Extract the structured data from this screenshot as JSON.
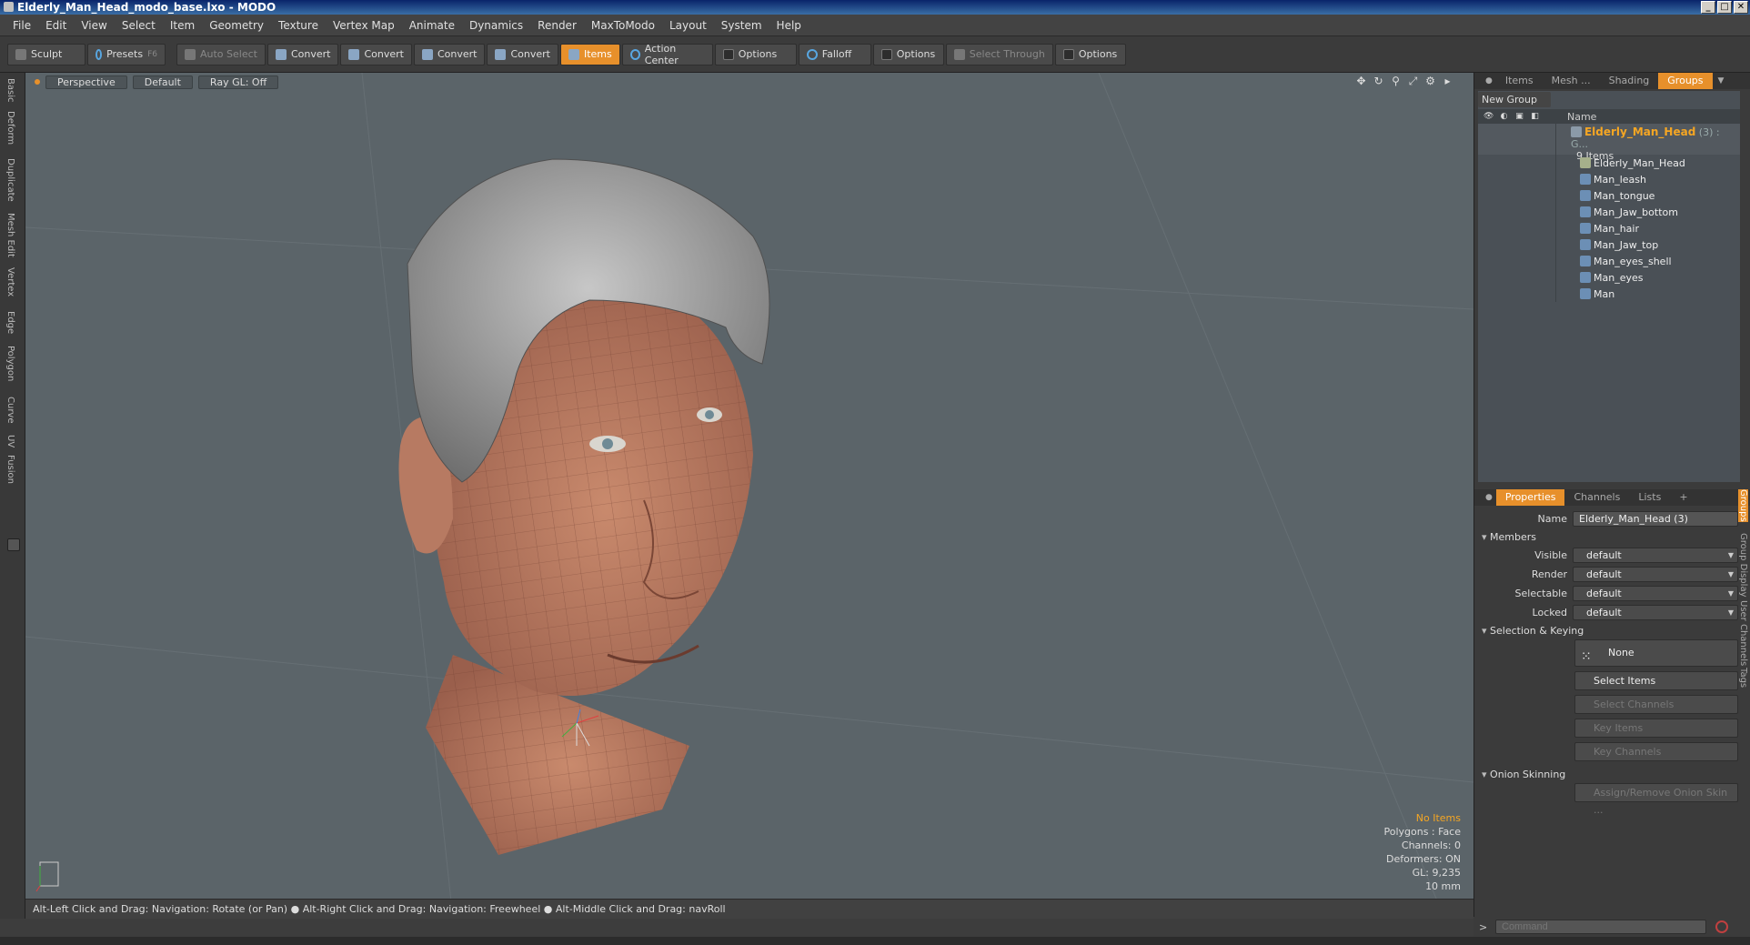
{
  "window": {
    "title": "Elderly_Man_Head_modo_base.lxo - MODO",
    "min": "_",
    "max": "□",
    "close": "✕"
  },
  "menu": [
    "File",
    "Edit",
    "View",
    "Select",
    "Item",
    "Geometry",
    "Texture",
    "Vertex Map",
    "Animate",
    "Dynamics",
    "Render",
    "MaxToModo",
    "Layout",
    "System",
    "Help"
  ],
  "toolbar": {
    "sculpt": "Sculpt",
    "presets": "Presets",
    "presets_key": "F6",
    "auto_select": "Auto Select",
    "convert1": "Convert",
    "convert2": "Convert",
    "convert3": "Convert",
    "convert4": "Convert",
    "items": "Items",
    "action_center": "Action Center",
    "options1": "Options",
    "falloff": "Falloff",
    "options2": "Options",
    "select_through": "Select Through",
    "options3": "Options"
  },
  "lefttabs": [
    "Basic",
    "Deform",
    "Duplicate",
    "Mesh Edit",
    "Vertex",
    "Edge",
    "Polygon",
    "Curve",
    "UV",
    "Fusion"
  ],
  "viewport": {
    "view": "Perspective",
    "shading": "Default",
    "raygl": "Ray GL: Off",
    "stats": {
      "items": "No Items",
      "polygons": "Polygons : Face",
      "channels": "Channels: 0",
      "deformers": "Deformers: ON",
      "gl": "GL: 9,235",
      "scale": "10 mm"
    },
    "hint": "Alt-Left Click and Drag: Navigation: Rotate (or Pan) ● Alt-Right Click and Drag: Navigation: Freewheel ● Alt-Middle Click and Drag: navRoll"
  },
  "rightpanel": {
    "tabs": [
      "Items",
      "Mesh ...",
      "Shading",
      "Groups"
    ],
    "new_group": "New Group",
    "tree_header": "Name",
    "group": {
      "name": "Elderly_Man_Head",
      "suffix": "(3) : G...",
      "count": "9 Items"
    },
    "members": [
      "Elderly_Man_Head",
      "Man_leash",
      "Man_tongue",
      "Man_Jaw_bottom",
      "Man_hair",
      "Man_Jaw_top",
      "Man_eyes_shell",
      "Man_eyes",
      "Man"
    ],
    "prop_tabs": [
      "Properties",
      "Channels",
      "Lists",
      "+"
    ],
    "props": {
      "name_label": "Name",
      "name_value": "Elderly_Man_Head (3)",
      "members_section": "Members",
      "visible_label": "Visible",
      "visible": "default",
      "render_label": "Render",
      "render": "default",
      "selectable_label": "Selectable",
      "selectable": "default",
      "locked_label": "Locked",
      "locked": "default",
      "sel_section": "Selection & Keying",
      "none": "None",
      "select_items": "Select Items",
      "select_channels": "Select Channels",
      "key_items": "Key Items",
      "key_channels": "Key Channels",
      "onion_section": "Onion Skinning",
      "onion_btn": "Assign/Remove Onion Skin ..."
    },
    "sidetabs": [
      "Groups",
      "Group Display",
      "User Channels",
      "Tags"
    ],
    "command_placeholder": "Command"
  }
}
